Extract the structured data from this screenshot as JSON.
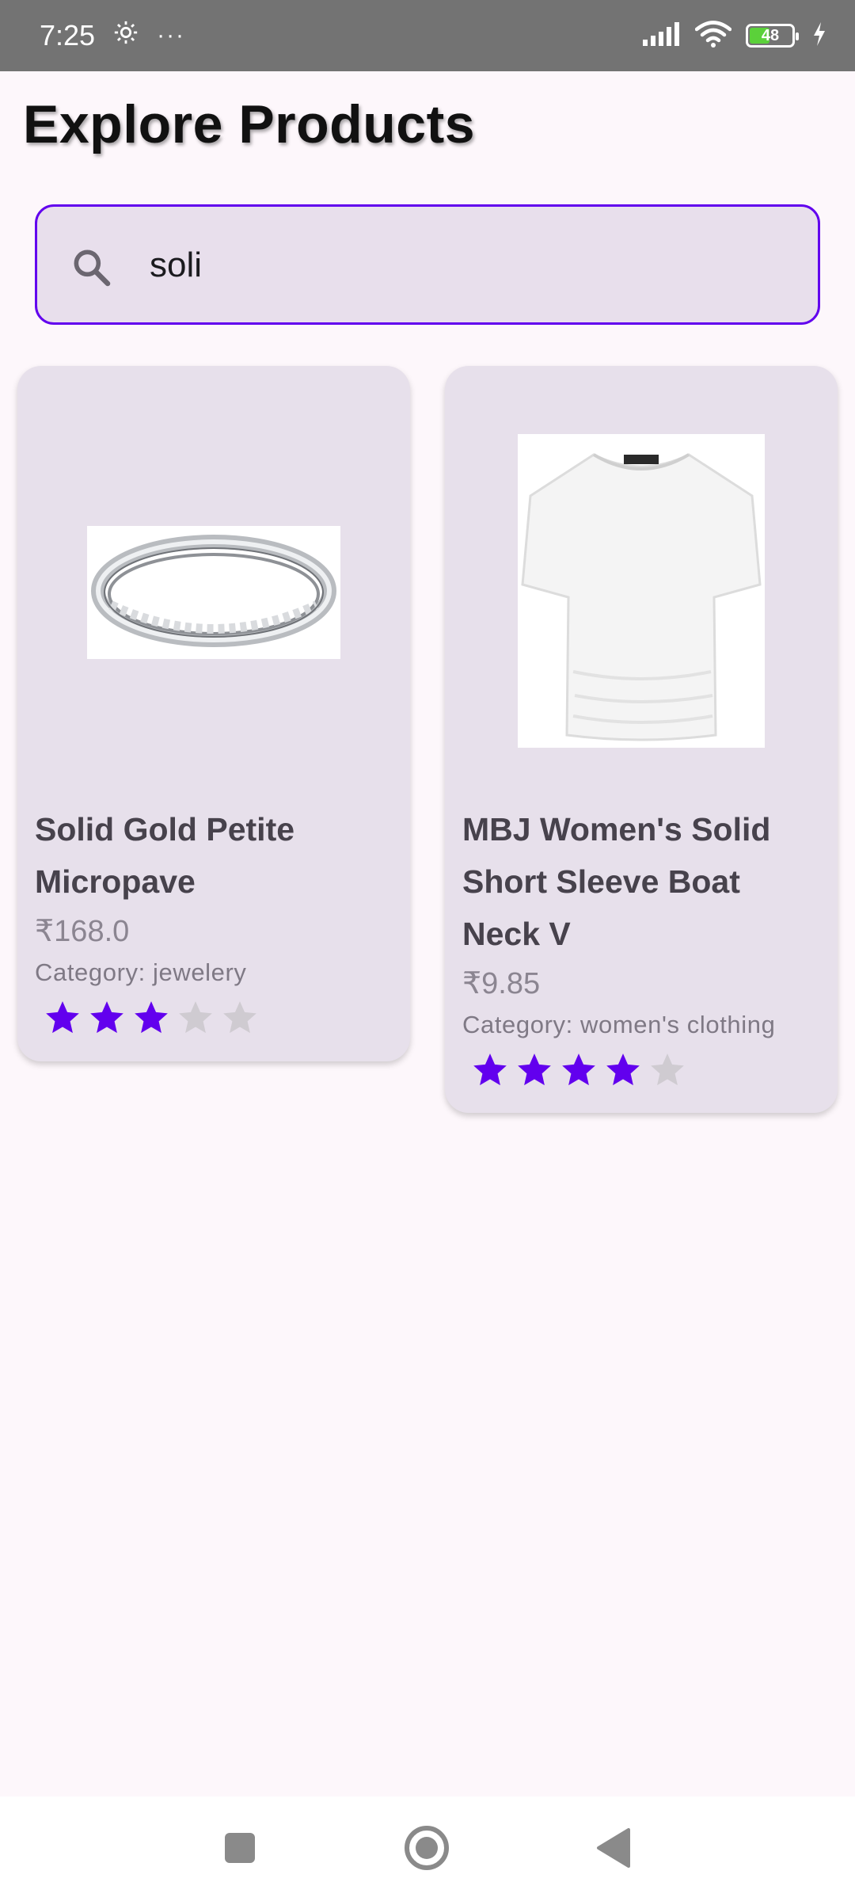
{
  "status_bar": {
    "time": "7:25",
    "more": "···",
    "battery_level": "48",
    "battery_percent": 48
  },
  "page": {
    "title": "Explore Products"
  },
  "search": {
    "value": "soli",
    "icon": "search-icon"
  },
  "products": [
    {
      "name": "Solid Gold Petite Micropave",
      "price": "₹168.0",
      "category": "Category: jewelery",
      "rating": 3,
      "rating_max": 5,
      "image": "ring-image"
    },
    {
      "name": "MBJ Women's Solid Short Sleeve Boat Neck V",
      "price": "₹9.85",
      "category": "Category: women's clothing",
      "rating": 4,
      "rating_max": 5,
      "image": "shirt-image"
    }
  ],
  "colors": {
    "accent": "#6200ee",
    "star_filled": "#6200ee",
    "star_empty": "#cfcbd1",
    "card_bg": "#e7e0eb"
  },
  "nav": {
    "recents_icon": "square-icon",
    "home_icon": "circle-icon",
    "back_icon": "triangle-back-icon"
  }
}
